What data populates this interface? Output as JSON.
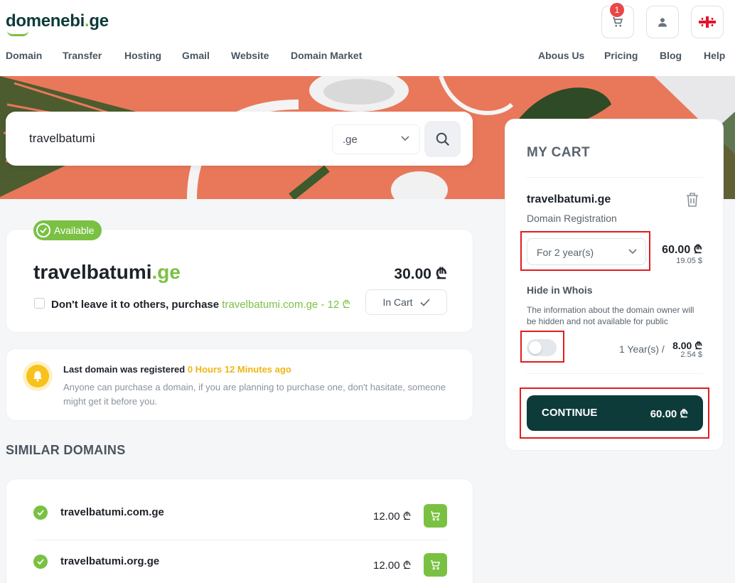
{
  "brand": {
    "logo_main": "domenebi",
    "logo_dot": ".",
    "logo_tld": "ge"
  },
  "nav_left": [
    "Domain",
    "Transfer",
    "Hosting",
    "Gmail",
    "Website",
    "Domain Market"
  ],
  "nav_right": [
    "Abous Us",
    "Pricing",
    "Blog",
    "Help"
  ],
  "header": {
    "cart_count": "1"
  },
  "search": {
    "query": "travelbatumi",
    "tld": ".ge"
  },
  "result": {
    "badge": "Available",
    "name": "travelbatumi",
    "tld": ".ge",
    "price": "30.00 ₾",
    "offer_text": "Don't leave it to others, purchase ",
    "offer_link": "travelbatumi.com.ge - 12 ₾",
    "in_cart_label": "In Cart"
  },
  "notice": {
    "title": "Last domain was registered ",
    "time": "0 Hours 12 Minutes ago",
    "text": "Anyone can purchase a domain, if you are planning to purchase one, don't hasitate, someone might get it before you."
  },
  "similar": {
    "title": "SIMILAR DOMAINS",
    "items": [
      {
        "name": "travelbatumi.com.ge",
        "price": "12.00 ₾"
      },
      {
        "name": "travelbatumi.org.ge",
        "price": "12.00 ₾"
      }
    ]
  },
  "cart": {
    "title": "MY CART",
    "domain": "travelbatumi.ge",
    "subtitle": "Domain Registration",
    "period": "For 2 year(s)",
    "price": "60.00 ₾",
    "usd": "19.05 $",
    "whois_title": "Hide in Whois",
    "whois_text": "The information about the domain owner will be hidden and not available for public",
    "whois_enabled": false,
    "whois_period": "1 Year(s) /",
    "whois_price": "8.00 ₾",
    "whois_usd": "2.54 $",
    "continue_label": "CONTINUE",
    "total": "60.00 ₾"
  },
  "colors": {
    "brand_dark": "#0c3b3a",
    "brand_green": "#7ac143",
    "hero": "#e9785a",
    "highlight": "#e01e1e"
  }
}
